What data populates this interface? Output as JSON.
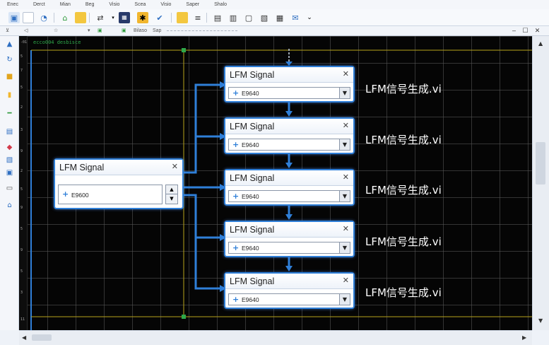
{
  "menu": [
    "Enec",
    "Derct",
    "Mian",
    "Beg",
    "Visio",
    "Scea",
    "Visio",
    "Saper",
    "Shalo"
  ],
  "subbar": {
    "items": [
      "Bilaso",
      "Sap"
    ]
  },
  "canvas": {
    "status_text": "ecco004 desbisce"
  },
  "main_node": {
    "title": "LFM Signal",
    "value": "E9600",
    "close": "✕",
    "plus": "+"
  },
  "signal_nodes": [
    {
      "title": "LFM Signal",
      "value": "E9640",
      "label": "LFM信号生成.vi"
    },
    {
      "title": "LFM Signal",
      "value": "E9640",
      "label": "LFM信号生成.vi"
    },
    {
      "title": "LFM Signal",
      "value": "E9640",
      "label": "LFM信号生成.vi"
    },
    {
      "title": "LFM Signal",
      "value": "E9640",
      "label": "LFM信号生成.vi"
    },
    {
      "title": "LFM Signal",
      "value": "E9640",
      "label": "LFM信号生成.vi"
    }
  ],
  "colors": {
    "wire": "#2f7fd8",
    "canvas": "#050505",
    "grid": "#5a5a5a"
  }
}
